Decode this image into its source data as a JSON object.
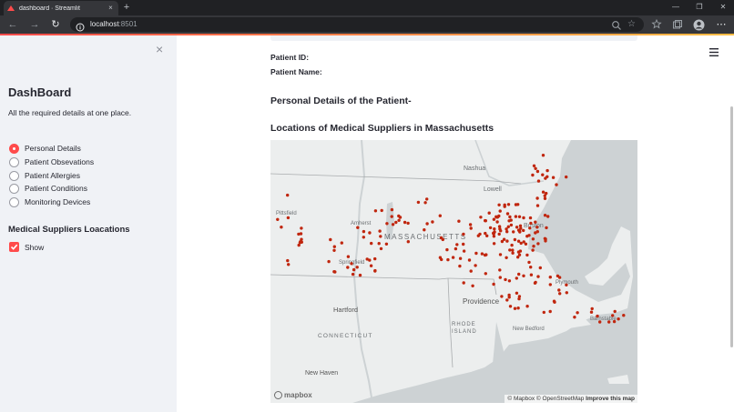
{
  "browser": {
    "tab_title": "dashboard · Streamlit",
    "tab_close": "×",
    "new_tab": "+",
    "url_host": "localhost",
    "url_port": ":8501",
    "window_controls": [
      "—",
      "❐",
      "✕"
    ],
    "nav": {
      "back": "←",
      "forward": "→",
      "reload": "↻"
    },
    "star": "☆",
    "menu": "⋯"
  },
  "sidebar": {
    "close": "×",
    "title": "DashBoard",
    "subtitle": "All the required details at one place.",
    "radio_options": [
      {
        "label": "Personal Details",
        "selected": true
      },
      {
        "label": "Patient Obsevations",
        "selected": false
      },
      {
        "label": "Patient Allergies",
        "selected": false
      },
      {
        "label": "Patient Conditions",
        "selected": false
      },
      {
        "label": "Monitoring Devices",
        "selected": false
      }
    ],
    "suppliers_heading": "Medical Suppliers Loacations",
    "show_checkbox": {
      "label": "Show",
      "checked": true
    }
  },
  "main": {
    "patient_id_label": "Patient ID:",
    "patient_name_label": "Patient Name:",
    "personal_details_heading": "Personal Details of the Patient-",
    "locations_heading": "Locations of Medical Suppliers in Massachusetts",
    "map": {
      "labels": {
        "nashua": "Nashua",
        "lowell": "Lowell",
        "pittsfield": "Pittsfield",
        "amherst": "Amherst",
        "massachusetts": "MASSACHUSETTS",
        "springfield": "Springfield",
        "boston": "Boston",
        "hartford": "Hartford",
        "providence": "Providence",
        "rhode_island_1": "RHODE",
        "rhode_island_2": "ISLAND",
        "connecticut": "CONNECTICUT",
        "new_haven": "New Haven",
        "new_bedford": "New Bedford",
        "barnstable": "Barnstable",
        "plymouth": "Plymouth"
      },
      "logo": "mapbox",
      "attribution_1": "© Mapbox © OpenStreetMap",
      "attribution_2": "Improve this map",
      "colors": {
        "land": "#eceeee",
        "water": "#cdd2d4",
        "point": "#c0260e"
      }
    }
  }
}
